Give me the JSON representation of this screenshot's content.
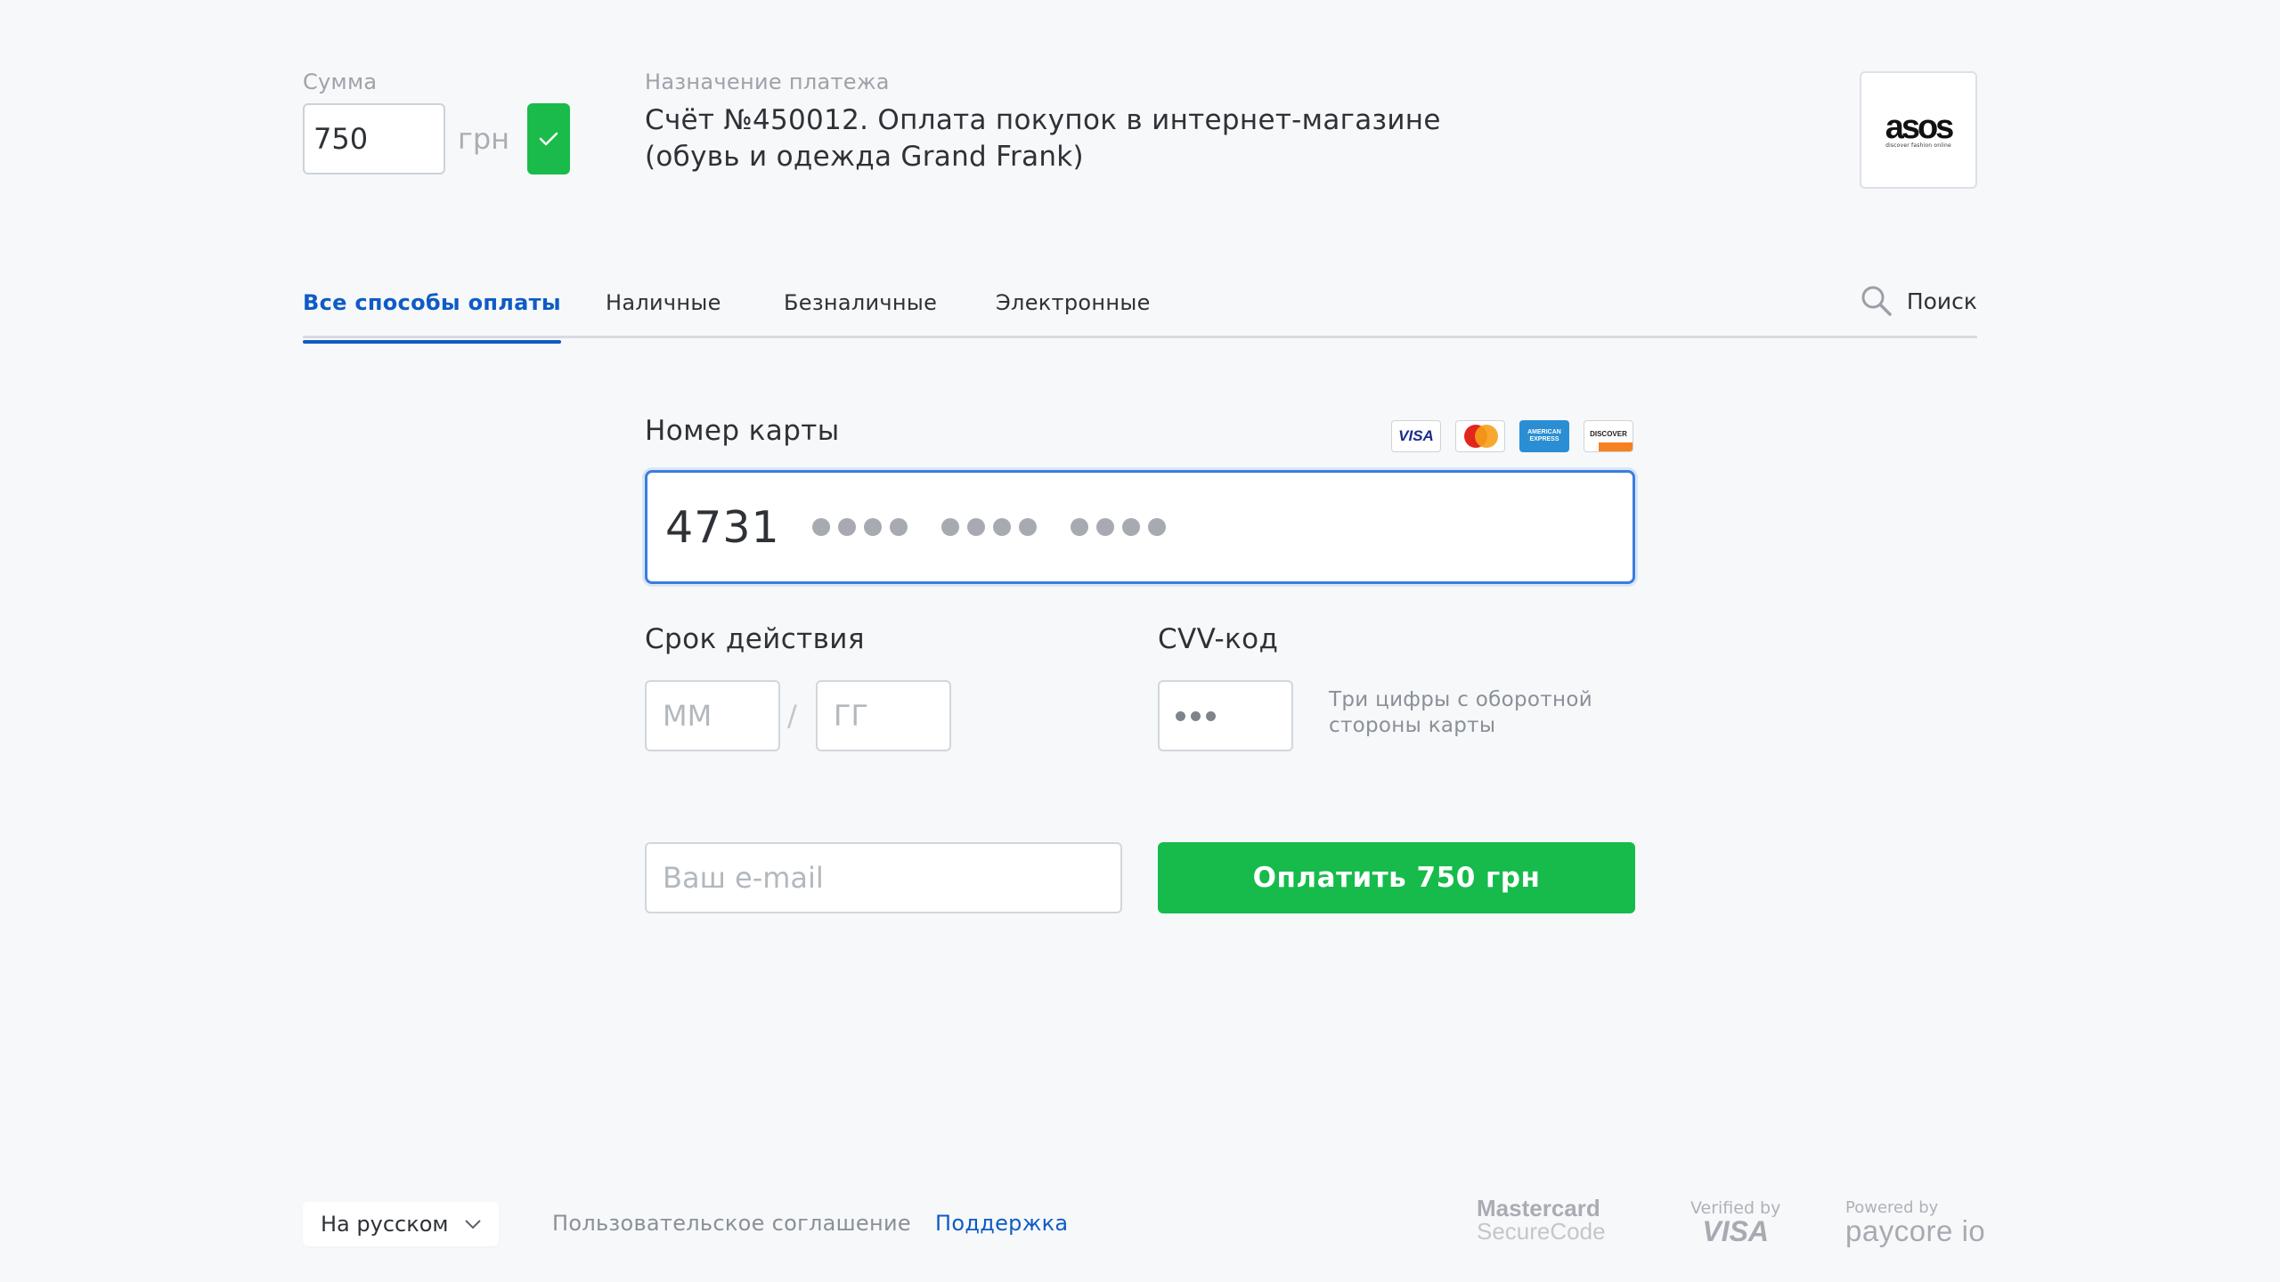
{
  "amount": {
    "label": "Сумма",
    "value": "750",
    "currency": "грн",
    "confirm_icon": "check-icon"
  },
  "purpose": {
    "label": "Назначение платежа",
    "text_line1": "Счёт №450012. Оплата покупок в интернет-магазине",
    "text_line2": "(обувь и одежда Grand Frank)"
  },
  "merchant": {
    "logo_word": "asos",
    "logo_tagline": "discover fashion online"
  },
  "tabs": [
    {
      "label": "Все способы оплаты",
      "active": true
    },
    {
      "label": "Наличные",
      "active": false
    },
    {
      "label": "Безналичные",
      "active": false
    },
    {
      "label": "Электронные",
      "active": false
    }
  ],
  "search": {
    "label": "Поиск",
    "icon": "search-icon"
  },
  "card": {
    "label": "Номер карты",
    "digits": "4731",
    "masked_groups": 3,
    "brands": [
      "VISA",
      "MasterCard",
      "AMERICAN EXPRESS",
      "DISCOVER"
    ]
  },
  "expiry": {
    "label": "Срок действия",
    "month_placeholder": "ММ",
    "year_placeholder": "ГГ",
    "separator": "/"
  },
  "cvv": {
    "label": "CVV-код",
    "hint_line1": "Три цифры с оборотной",
    "hint_line2": "стороны карты"
  },
  "email": {
    "placeholder": "Ваш e-mail"
  },
  "pay_button": {
    "label": "Оплатить 750 грн"
  },
  "footer": {
    "language": "На русском",
    "agreement_link": "Пользовательское соглашение",
    "support_link": "Поддержка",
    "badges": {
      "mastercard_line1": "Mastercard",
      "mastercard_line2": "SecureCode",
      "visa_line1": "Verified by",
      "visa_line2": "VISA",
      "paycore_line1": "Powered by",
      "paycore_line2": "paycore io"
    }
  },
  "colors": {
    "accent_blue": "#0f5bc4",
    "success_green": "#16bb4b",
    "background": "#f6f8fa"
  }
}
